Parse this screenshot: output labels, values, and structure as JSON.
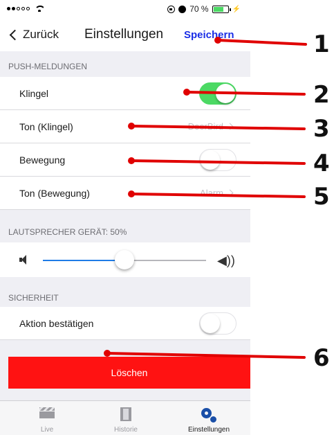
{
  "status_bar": {
    "signal_dots": 5,
    "battery": "70 %",
    "battery_level": 0.7
  },
  "nav": {
    "back_label": "Zurück",
    "title": "Einstellungen",
    "save_label": "Speichern"
  },
  "push": {
    "header": "PUSH-MELDUNGEN",
    "rows": [
      {
        "label": "Klingel",
        "toggle": true
      },
      {
        "label": "Ton (Klingel)",
        "value": "DoorBird"
      },
      {
        "label": "Bewegung",
        "toggle": false
      },
      {
        "label": "Ton (Bewegung)",
        "value": "Alarm"
      }
    ]
  },
  "speaker": {
    "header": "LAUTSPRECHER GERÄT: 50%",
    "level": 0.5
  },
  "security": {
    "header": "SICHERHEIT",
    "confirm_label": "Aktion bestätigen",
    "confirm_toggle": false
  },
  "delete_label": "Löschen",
  "tabs": [
    {
      "label": "Live",
      "icon": "clapperboard-icon",
      "active": false
    },
    {
      "label": "Historie",
      "icon": "film-icon",
      "active": false
    },
    {
      "label": "Einstellungen",
      "icon": "gears-icon",
      "active": true
    }
  ],
  "annotations": [
    "1",
    "2",
    "3",
    "4",
    "5",
    "6"
  ],
  "colors": {
    "accent": "#1a2ee6",
    "toggle_on": "#4cd964",
    "delete": "#ff1212",
    "annotation": "#e00000",
    "slider": "#1f7ce6"
  }
}
